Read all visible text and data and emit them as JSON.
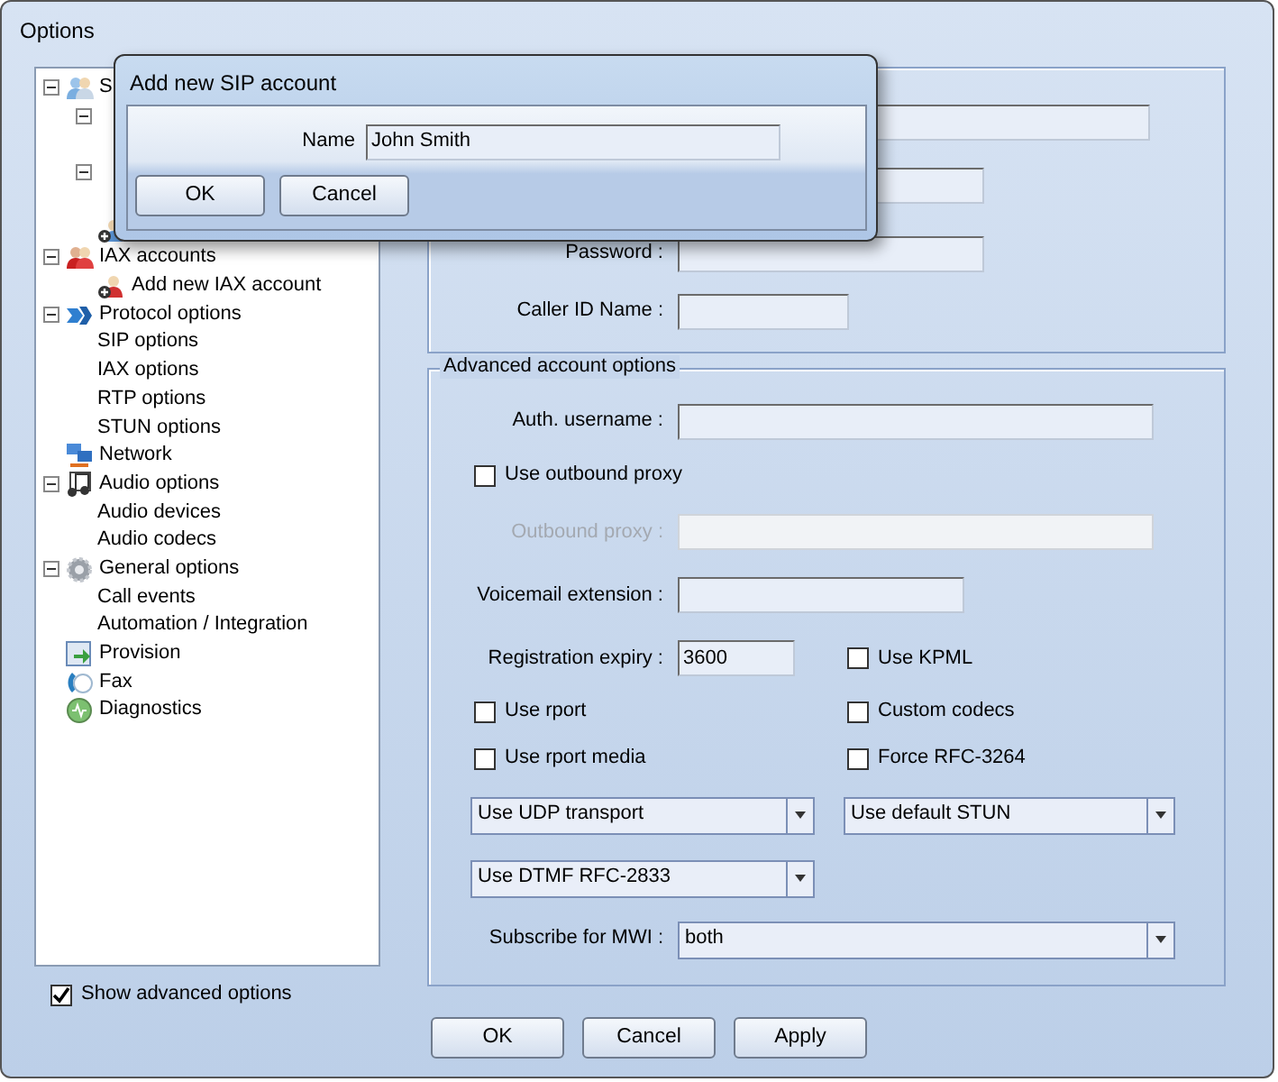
{
  "window": {
    "title": "Options"
  },
  "tree": [
    {
      "label": "S",
      "kind": "sip",
      "expanded": true,
      "children": [
        {
          "expanded": true
        },
        {
          "expanded": true
        },
        {
          "kind": "add-sip"
        }
      ]
    },
    {
      "label": "IAX accounts",
      "kind": "iax",
      "expanded": true,
      "children": [
        {
          "label": "Add new IAX account",
          "kind": "add-iax"
        }
      ]
    },
    {
      "label": "Protocol options",
      "kind": "protocol",
      "expanded": true,
      "children": [
        {
          "label": "SIP options"
        },
        {
          "label": "IAX options"
        },
        {
          "label": "RTP options"
        },
        {
          "label": "STUN options"
        }
      ]
    },
    {
      "label": "Network",
      "kind": "network"
    },
    {
      "label": "Audio options",
      "kind": "audio",
      "expanded": true,
      "children": [
        {
          "label": "Audio devices"
        },
        {
          "label": "Audio codecs"
        }
      ]
    },
    {
      "label": "General options",
      "kind": "general",
      "expanded": true,
      "children": [
        {
          "label": "Call events"
        },
        {
          "label": "Automation / Integration"
        }
      ]
    },
    {
      "label": "Provision",
      "kind": "provision"
    },
    {
      "label": "Fax",
      "kind": "fax"
    },
    {
      "label": "Diagnostics",
      "kind": "diagnostics"
    }
  ],
  "show_advanced": {
    "label": "Show advanced options",
    "checked": true
  },
  "account_fields": [
    {
      "kind": "field"
    },
    {
      "kind": "field"
    },
    {
      "kind": "field",
      "label": "Password :"
    },
    {
      "kind": "field",
      "label": "Caller ID Name :"
    }
  ],
  "advanced": {
    "title": "Advanced account options",
    "auth_username": {
      "label": "Auth. username :"
    },
    "use_outbound_proxy": {
      "label": "Use outbound proxy",
      "checked": false
    },
    "outbound_proxy": {
      "label": "Outbound proxy :",
      "disabled": true
    },
    "voicemail": {
      "label": "Voicemail extension :"
    },
    "registration_expiry": {
      "label": "Registration expiry  :",
      "value": "3600"
    },
    "checks": [
      {
        "label": "Use KPML",
        "checked": false
      },
      {
        "label": "Use rport",
        "checked": false
      },
      {
        "label": "Custom codecs",
        "checked": false
      },
      {
        "label": "Use rport media",
        "checked": false
      },
      {
        "label": "Force RFC-3264",
        "checked": false
      }
    ],
    "transport": {
      "value": "Use UDP transport"
    },
    "stun": {
      "value": "Use default STUN"
    },
    "dtmf": {
      "value": "Use DTMF RFC-2833"
    },
    "mwi": {
      "label": "Subscribe for MWI :",
      "value": "both"
    }
  },
  "buttons": [
    "OK",
    "Cancel",
    "Apply"
  ],
  "dialog": {
    "title": "Add new SIP account",
    "name_label": "Name",
    "name_value": "John Smith",
    "buttons": [
      "OK",
      "Cancel"
    ]
  }
}
